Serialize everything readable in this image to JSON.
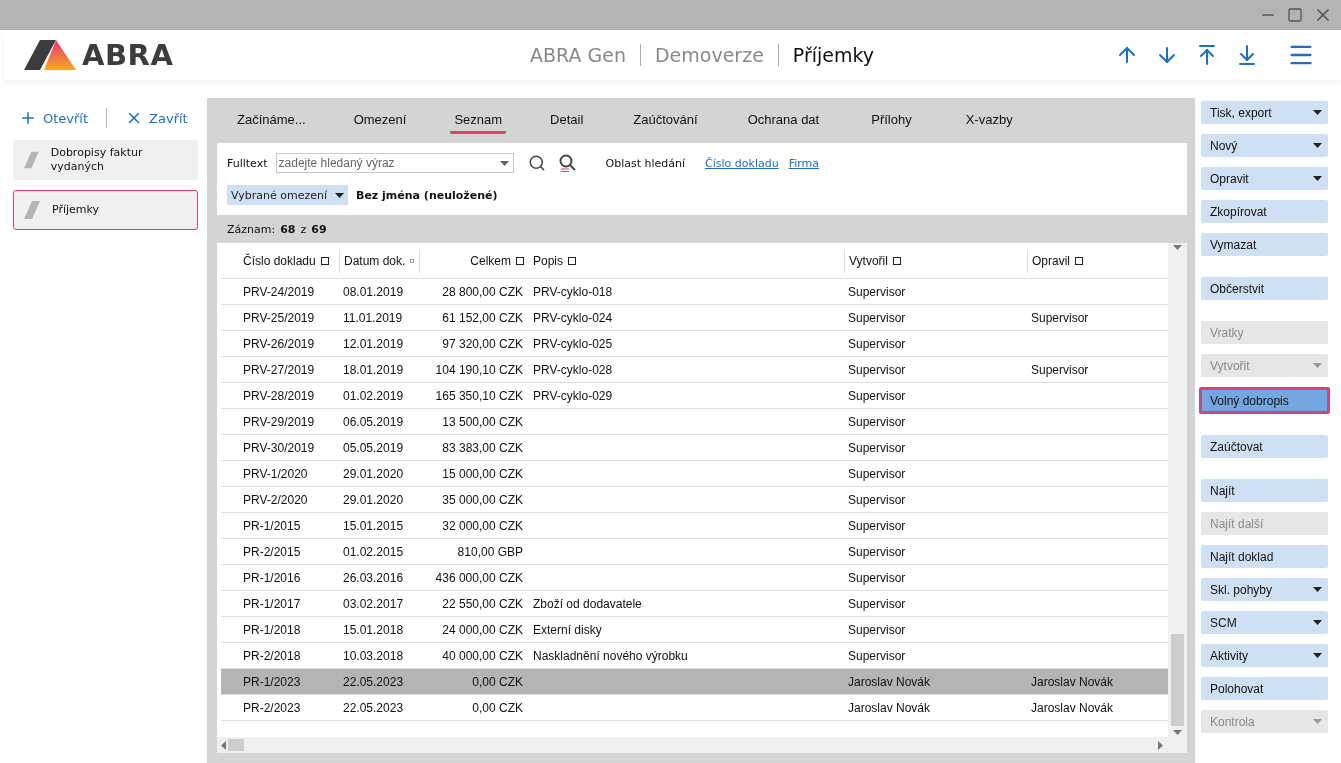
{
  "header": {
    "logo": "ABRA",
    "crumbs": [
      {
        "label": "ABRA Gen",
        "current": false
      },
      {
        "label": "Demoverze",
        "current": false
      },
      {
        "label": "Příjemky",
        "current": true
      }
    ]
  },
  "sidebar": {
    "actions": [
      {
        "kind": "open",
        "label": "Otevřít"
      },
      {
        "kind": "close",
        "label": "Zavřít"
      }
    ],
    "items": [
      {
        "label": "Dobropisy faktur vydaných",
        "selected": false
      },
      {
        "label": "Příjemky",
        "selected": true
      }
    ]
  },
  "tabs": [
    {
      "label": "Začínáme...",
      "selected": false
    },
    {
      "label": "Omezení",
      "selected": false
    },
    {
      "label": "Seznam",
      "selected": true
    },
    {
      "label": "Detail",
      "selected": false
    },
    {
      "label": "Zaúčtování",
      "selected": false
    },
    {
      "label": "Ochrana dat",
      "selected": false
    },
    {
      "label": "Přílohy",
      "selected": false
    },
    {
      "label": "X-vazby",
      "selected": false
    }
  ],
  "filter": {
    "fulltext_label": "Fulltext",
    "placeholder": "zadejte hledaný výraz",
    "area_label": "Oblast hledání",
    "area_links": [
      "Číslo dokladu",
      "Firma"
    ],
    "restriction_button": "Vybrané omezení",
    "restriction_name": "Bez jména (neuložené)"
  },
  "record_count": {
    "label": "Záznam:",
    "current": "68",
    "of": "z",
    "total": "69"
  },
  "table": {
    "columns": [
      {
        "label": "Číslo dokladu"
      },
      {
        "label": "Datum dok."
      },
      {
        "label": "Celkem"
      },
      {
        "label": "Popis"
      },
      {
        "label": "Vytvořil"
      },
      {
        "label": "Opravil"
      }
    ],
    "rows": [
      {
        "selected": false,
        "cells": [
          "PRV-24/2019",
          "08.01.2019",
          "28 800,00 CZK",
          "PRV-cyklo-018",
          "Supervisor",
          ""
        ]
      },
      {
        "selected": false,
        "cells": [
          "PRV-25/2019",
          "11.01.2019",
          "61 152,00 CZK",
          "PRV-cyklo-024",
          "Supervisor",
          "Supervisor"
        ]
      },
      {
        "selected": false,
        "cells": [
          "PRV-26/2019",
          "12.01.2019",
          "97 320,00 CZK",
          "PRV-cyklo-025",
          "Supervisor",
          ""
        ]
      },
      {
        "selected": false,
        "cells": [
          "PRV-27/2019",
          "18.01.2019",
          "104 190,10 CZK",
          "PRV-cyklo-028",
          "Supervisor",
          "Supervisor"
        ]
      },
      {
        "selected": false,
        "cells": [
          "PRV-28/2019",
          "01.02.2019",
          "165 350,10 CZK",
          "PRV-cyklo-029",
          "Supervisor",
          ""
        ]
      },
      {
        "selected": false,
        "cells": [
          "PRV-29/2019",
          "06.05.2019",
          "13 500,00 CZK",
          "",
          "Supervisor",
          ""
        ]
      },
      {
        "selected": false,
        "cells": [
          "PRV-30/2019",
          "05.05.2019",
          "83 383,00 CZK",
          "",
          "Supervisor",
          ""
        ]
      },
      {
        "selected": false,
        "cells": [
          "PRV-1/2020",
          "29.01.2020",
          "15 000,00 CZK",
          "",
          "Supervisor",
          ""
        ]
      },
      {
        "selected": false,
        "cells": [
          "PRV-2/2020",
          "29.01.2020",
          "35 000,00 CZK",
          "",
          "Supervisor",
          ""
        ]
      },
      {
        "selected": false,
        "cells": [
          "PR-1/2015",
          "15.01.2015",
          "32 000,00 CZK",
          "",
          "Supervisor",
          ""
        ]
      },
      {
        "selected": false,
        "cells": [
          "PR-2/2015",
          "01.02.2015",
          "810,00 GBP",
          "",
          "Supervisor",
          ""
        ]
      },
      {
        "selected": false,
        "cells": [
          "PR-1/2016",
          "26.03.2016",
          "436 000,00 CZK",
          "",
          "Supervisor",
          ""
        ]
      },
      {
        "selected": false,
        "cells": [
          "PR-1/2017",
          "03.02.2017",
          "22 550,00 CZK",
          "Zboží od dodavatele",
          "Supervisor",
          ""
        ]
      },
      {
        "selected": false,
        "cells": [
          "PR-1/2018",
          "15.01.2018",
          "24 000,00 CZK",
          "Externí disky",
          "Supervisor",
          ""
        ]
      },
      {
        "selected": false,
        "cells": [
          "PR-2/2018",
          "10.03.2018",
          "40 000,00 CZK",
          "Naskladnění nového výrobku",
          "Supervisor",
          ""
        ]
      },
      {
        "selected": true,
        "cells": [
          "PR-1/2023",
          "22.05.2023",
          "0,00 CZK",
          "",
          "Jaroslav Novák",
          "Jaroslav Novák"
        ]
      },
      {
        "selected": false,
        "cells": [
          "PR-2/2023",
          "22.05.2023",
          "0,00 CZK",
          "",
          "Jaroslav Novák",
          "Jaroslav Novák"
        ]
      }
    ]
  },
  "action_groups": [
    [
      {
        "label": "Tisk, export",
        "dropdown": true,
        "disabled": false,
        "focused": false
      },
      {
        "label": "Nový",
        "dropdown": true,
        "disabled": false,
        "focused": false
      },
      {
        "label": "Opravit",
        "dropdown": true,
        "disabled": false,
        "focused": false
      },
      {
        "label": "Zkopírovat",
        "dropdown": false,
        "disabled": false,
        "focused": false
      },
      {
        "label": "Vymazat",
        "dropdown": false,
        "disabled": false,
        "focused": false
      }
    ],
    [
      {
        "label": "Občerstvit",
        "dropdown": false,
        "disabled": false,
        "focused": false
      }
    ],
    [
      {
        "label": "Vratky",
        "dropdown": false,
        "disabled": true,
        "focused": false
      },
      {
        "label": "Vytvořit",
        "dropdown": true,
        "disabled": true,
        "focused": false
      },
      {
        "label": "Volný dobropis",
        "dropdown": false,
        "disabled": false,
        "focused": true
      }
    ],
    [
      {
        "label": "Zaúčtovat",
        "dropdown": false,
        "disabled": false,
        "focused": false
      }
    ],
    [
      {
        "label": "Najít",
        "dropdown": false,
        "disabled": false,
        "focused": false
      },
      {
        "label": "Najít další",
        "dropdown": false,
        "disabled": true,
        "focused": false
      },
      {
        "label": "Najít doklad",
        "dropdown": false,
        "disabled": false,
        "focused": false
      },
      {
        "label": "Skl. pohyby",
        "dropdown": true,
        "disabled": false,
        "focused": false
      },
      {
        "label": "SCM",
        "dropdown": true,
        "disabled": false,
        "focused": false
      },
      {
        "label": "Aktivity",
        "dropdown": true,
        "disabled": false,
        "focused": false
      },
      {
        "label": "Polohovat",
        "dropdown": false,
        "disabled": false,
        "focused": false
      },
      {
        "label": "Kontrola",
        "dropdown": true,
        "disabled": true,
        "focused": false
      }
    ]
  ]
}
